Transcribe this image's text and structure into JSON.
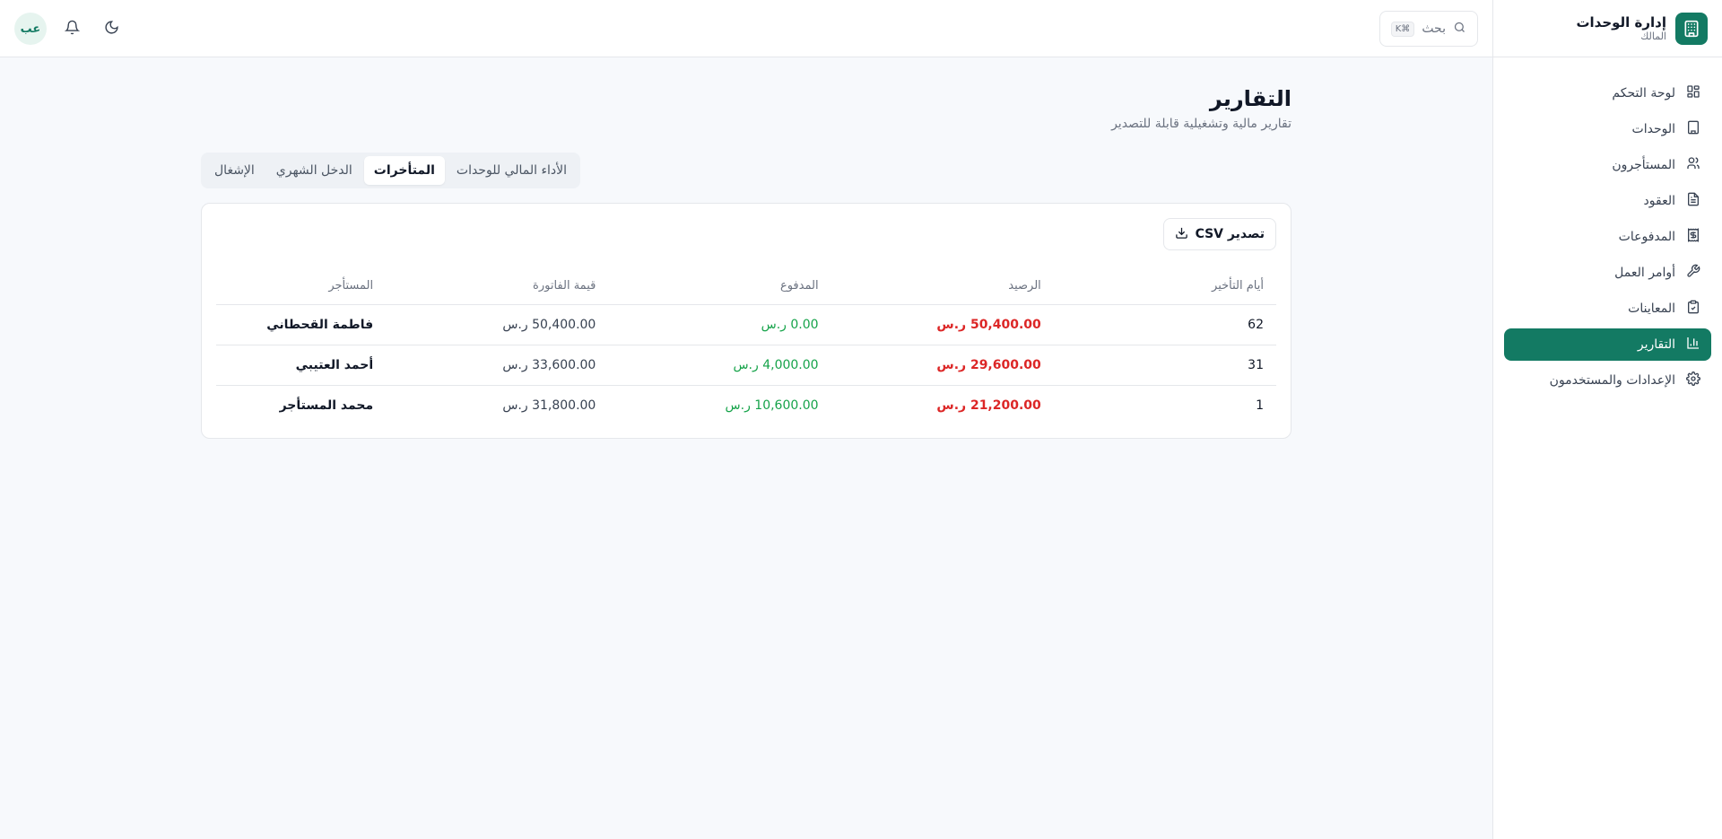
{
  "brand": {
    "title": "إدارة الوحدات",
    "subtitle": "المالك"
  },
  "nav": [
    {
      "label": "لوحة التحكم",
      "icon": "dashboard-icon"
    },
    {
      "label": "الوحدات",
      "icon": "building-icon"
    },
    {
      "label": "المستأجرون",
      "icon": "users-icon"
    },
    {
      "label": "العقود",
      "icon": "document-icon"
    },
    {
      "label": "المدفوعات",
      "icon": "receipt-icon"
    },
    {
      "label": "أوامر العمل",
      "icon": "wrench-icon"
    },
    {
      "label": "المعاينات",
      "icon": "clipboard-check-icon"
    },
    {
      "label": "التقارير",
      "icon": "chart-icon",
      "active": true
    },
    {
      "label": "الإعدادات والمستخدمون",
      "icon": "gear-icon"
    }
  ],
  "header": {
    "search_placeholder": "بحث",
    "shortcut": "K⌘",
    "avatar": "عب"
  },
  "page": {
    "title": "التقارير",
    "subtitle": "تقارير مالية وتشغيلية قابلة للتصدير"
  },
  "tabs": [
    {
      "label": "الأداء المالي للوحدات"
    },
    {
      "label": "المتأخرات",
      "active": true
    },
    {
      "label": "الدخل الشهري"
    },
    {
      "label": "الإشغال"
    }
  ],
  "export_label": "تصدير CSV",
  "table": {
    "headers": {
      "tenant": "المستأجر",
      "invoice": "قيمة الفاتورة",
      "paid": "المدفوع",
      "balance": "الرصيد",
      "days": "أيام التأخير"
    },
    "rows": [
      {
        "tenant": "فاطمة القحطاني",
        "invoice": "50,400.00 ر.س",
        "paid": "0.00 ر.س",
        "balance": "50,400.00 ر.س",
        "days": "62"
      },
      {
        "tenant": "أحمد العتيبي",
        "invoice": "33,600.00 ر.س",
        "paid": "4,000.00 ر.س",
        "balance": "29,600.00 ر.س",
        "days": "31"
      },
      {
        "tenant": "محمد المستأجر",
        "invoice": "31,800.00 ر.س",
        "paid": "10,600.00 ر.س",
        "balance": "21,200.00 ر.س",
        "days": "1"
      }
    ]
  },
  "colors": {
    "brand": "#137a63",
    "paid": "#16a34a",
    "balance": "#dc2626"
  }
}
